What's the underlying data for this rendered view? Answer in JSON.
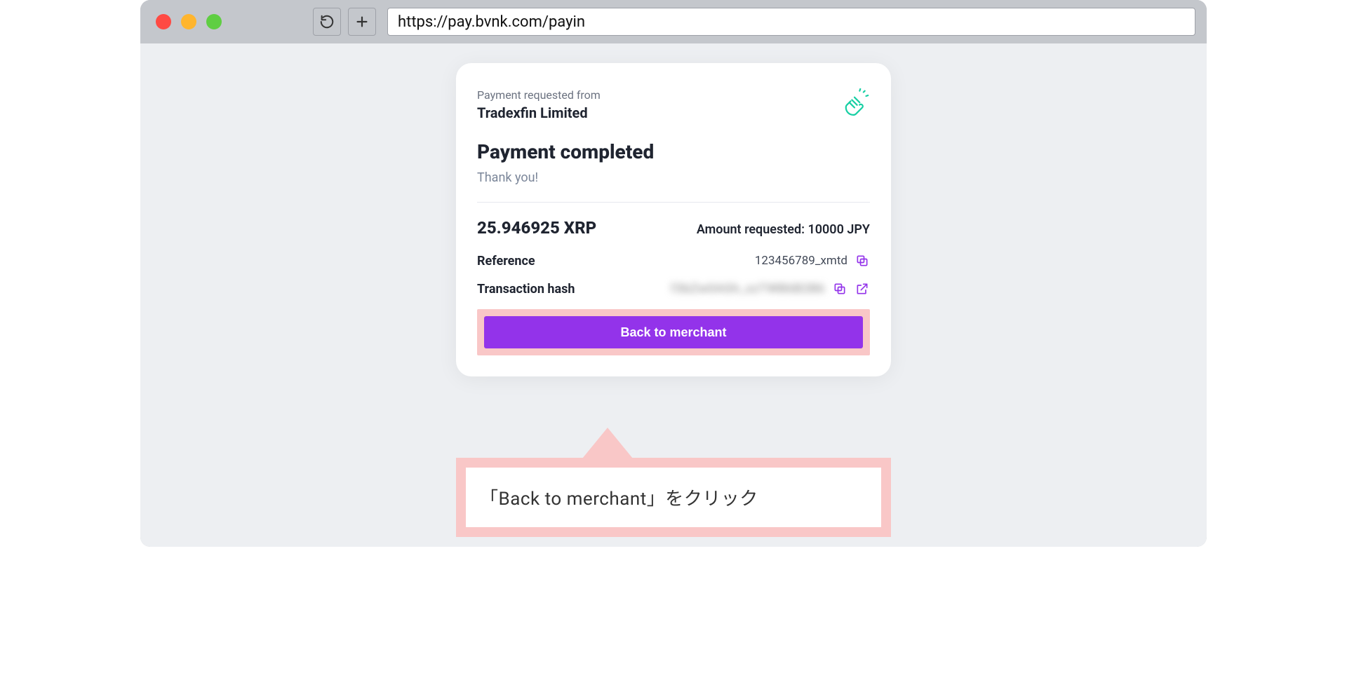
{
  "browser": {
    "url": "https://pay.bvnk.com/payin"
  },
  "card": {
    "requested_from_label": "Payment requested from",
    "merchant_name": "Tradexfin Limited",
    "headline": "Payment completed",
    "thank_you": "Thank you!",
    "amount_crypto": "25.946925 XRP",
    "amount_requested_label": "Amount requested: 10000 JPY",
    "reference_label": "Reference",
    "reference_value": "123456789_xmtd",
    "hash_label": "Transaction hash",
    "hash_value": "f3bZw0AGh_xzTWB6B2B6",
    "back_button_label": "Back to merchant"
  },
  "callout": {
    "text": "「Back to merchant」をクリック"
  }
}
